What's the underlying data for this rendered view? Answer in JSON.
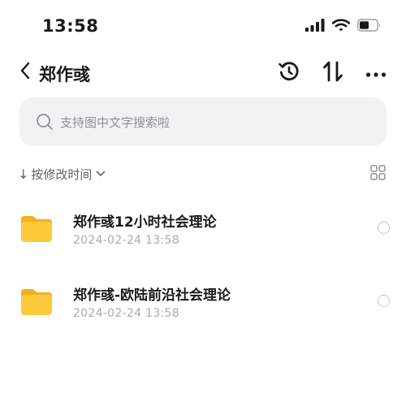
{
  "status_bar": {
    "time": "13:58",
    "icons": [
      "signal-icon",
      "wifi-icon",
      "battery-icon"
    ]
  },
  "nav": {
    "back_icon": "chevron-left-icon",
    "title": "郑作彧",
    "actions": [
      "history-icon",
      "sort-updown-icon",
      "more-icon"
    ]
  },
  "search": {
    "placeholder": "支持图中文字搜索啦",
    "icon": "search-icon"
  },
  "sort": {
    "label": "按修改时间",
    "arrow": "↓",
    "chevron_icon": "chevron-down-icon",
    "view_toggle_icon": "grid-view-icon"
  },
  "files": [
    {
      "name": "郑作彧12小时社会理论",
      "date": "2024-02-24 13:58",
      "icon": "folder-icon",
      "selected": false
    },
    {
      "name": "郑作彧-欧陆前沿社会理论",
      "date": "2024-02-24 13:58",
      "icon": "folder-icon",
      "selected": false
    }
  ],
  "colors": {
    "folder": "#fcc93b",
    "search_bg": "#f1f2f6",
    "secondary_text": "#a7aab1"
  }
}
